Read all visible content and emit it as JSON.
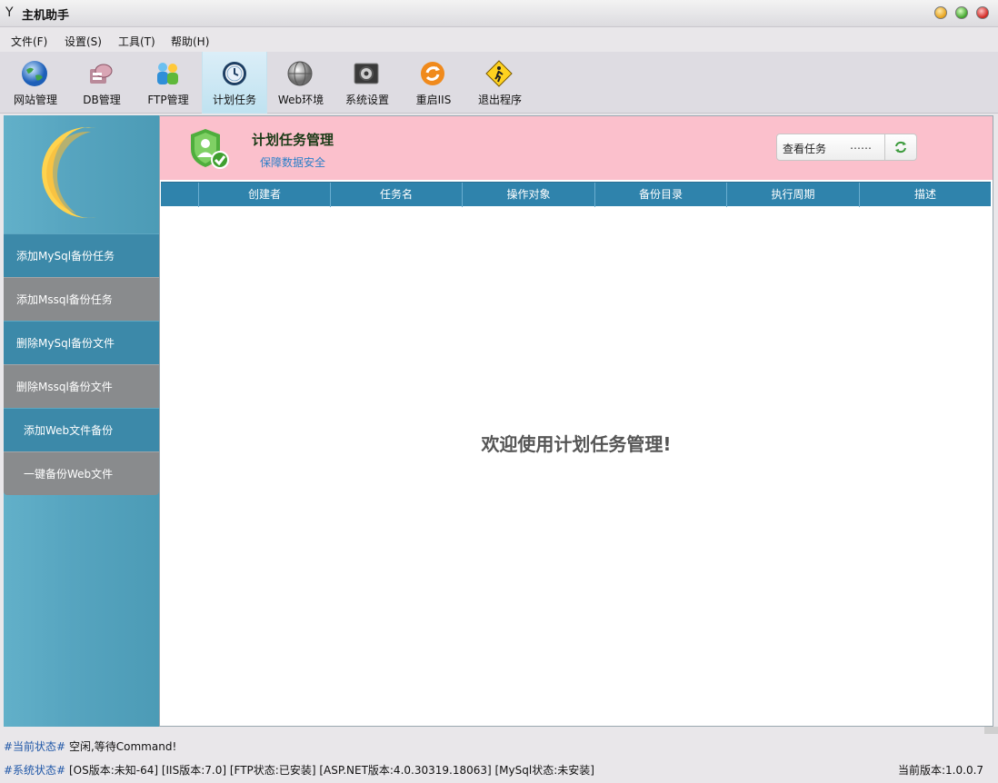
{
  "window": {
    "logo": "Y",
    "title": "主机助手"
  },
  "menu": [
    "文件(F)",
    "设置(S)",
    "工具(T)",
    "帮助(H)"
  ],
  "toolbar": [
    {
      "label": "网站管理",
      "icon": "globe-icon"
    },
    {
      "label": "DB管理",
      "icon": "database-icon"
    },
    {
      "label": "FTP管理",
      "icon": "users-icon"
    },
    {
      "label": "计划任务",
      "icon": "clock-icon",
      "active": true
    },
    {
      "label": "Web环境",
      "icon": "web-globe-icon"
    },
    {
      "label": "系统设置",
      "icon": "settings-icon"
    },
    {
      "label": "重启IIS",
      "icon": "restart-icon"
    },
    {
      "label": "退出程序",
      "icon": "exit-sign-icon"
    }
  ],
  "sidebar": {
    "items": [
      {
        "label": "添加MySql备份任务"
      },
      {
        "label": "添加Mssql备份任务"
      },
      {
        "label": "删除MySql备份文件"
      },
      {
        "label": "删除Mssql备份文件"
      },
      {
        "label": "添加Web文件备份"
      },
      {
        "label": "一键备份Web文件"
      }
    ]
  },
  "banner": {
    "title": "计划任务管理",
    "subtitle": "保障数据安全",
    "task_select_label": "查看任务",
    "task_select_value": "……"
  },
  "table": {
    "columns": [
      "",
      "创建者",
      "任务名",
      "操作对象",
      "备份目录",
      "执行周期",
      "描述"
    ]
  },
  "welcome": "欢迎使用计划任务管理!",
  "status": {
    "current_key": "#当前状态#",
    "current_value": "空闲,等待Command!",
    "system_key": "#系统状态#",
    "system_value": "[OS版本:未知-64] [IIS版本:7.0] [FTP状态:已安装] [ASP.NET版本:4.0.30319.18063] [MySql状态:未安装]",
    "version": "当前版本:1.0.0.7"
  },
  "colors": {
    "banner_bg": "#fbc0cc",
    "table_header": "#2f83ac",
    "sidebar_blue": "#3c89a9",
    "sidebar_gray": "#898b8d"
  }
}
